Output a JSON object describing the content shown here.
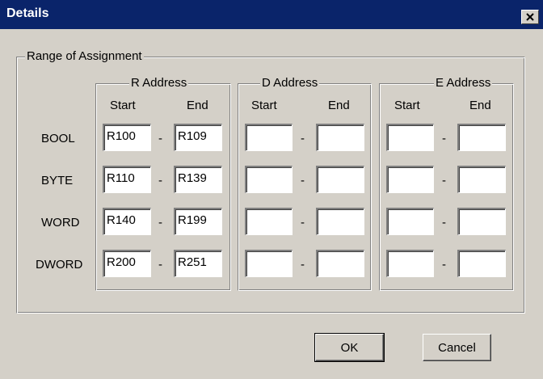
{
  "window": {
    "title": "Details",
    "close_icon": "close-icon"
  },
  "range_group": {
    "label": "Range of Assignment"
  },
  "groups": [
    {
      "label": "R Address",
      "start_header": "Start",
      "end_header": "End"
    },
    {
      "label": "D Address",
      "start_header": "Start",
      "end_header": "End"
    },
    {
      "label": "E Address",
      "start_header": "Start",
      "end_header": "End"
    }
  ],
  "rows": [
    {
      "label": "BOOL",
      "r_start": "R100",
      "r_end": "R109",
      "d_start": "",
      "d_end": "",
      "e_start": "",
      "e_end": ""
    },
    {
      "label": "BYTE",
      "r_start": "R110",
      "r_end": "R139",
      "d_start": "",
      "d_end": "",
      "e_start": "",
      "e_end": ""
    },
    {
      "label": "WORD",
      "r_start": "R140",
      "r_end": "R199",
      "d_start": "",
      "d_end": "",
      "e_start": "",
      "e_end": ""
    },
    {
      "label": "DWORD",
      "r_start": "R200",
      "r_end": "R251",
      "d_start": "",
      "d_end": "",
      "e_start": "",
      "e_end": ""
    }
  ],
  "separator": "-",
  "buttons": {
    "ok": "OK",
    "cancel": "Cancel"
  }
}
